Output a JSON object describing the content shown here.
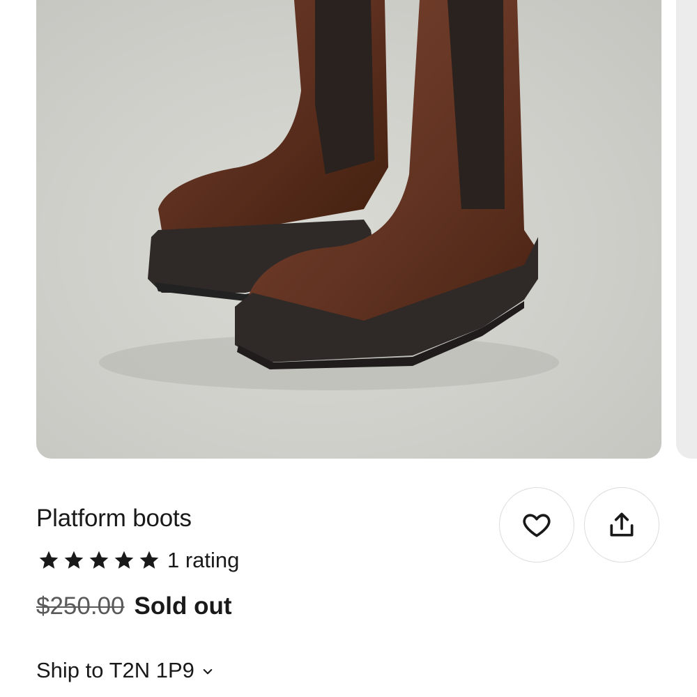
{
  "product": {
    "title": "Platform boots",
    "rating_stars": 5,
    "rating_count_label": "1 rating",
    "original_price": "$250.00",
    "status": "Sold out"
  },
  "shipping": {
    "label": "Ship to T2N 1P9"
  },
  "actions": {
    "favorite_icon": "heart-icon",
    "share_icon": "share-icon"
  },
  "colors": {
    "text": "#191919",
    "muted_price": "#595959",
    "border": "#dcdcdc",
    "image_bg": "#cfcfca"
  }
}
